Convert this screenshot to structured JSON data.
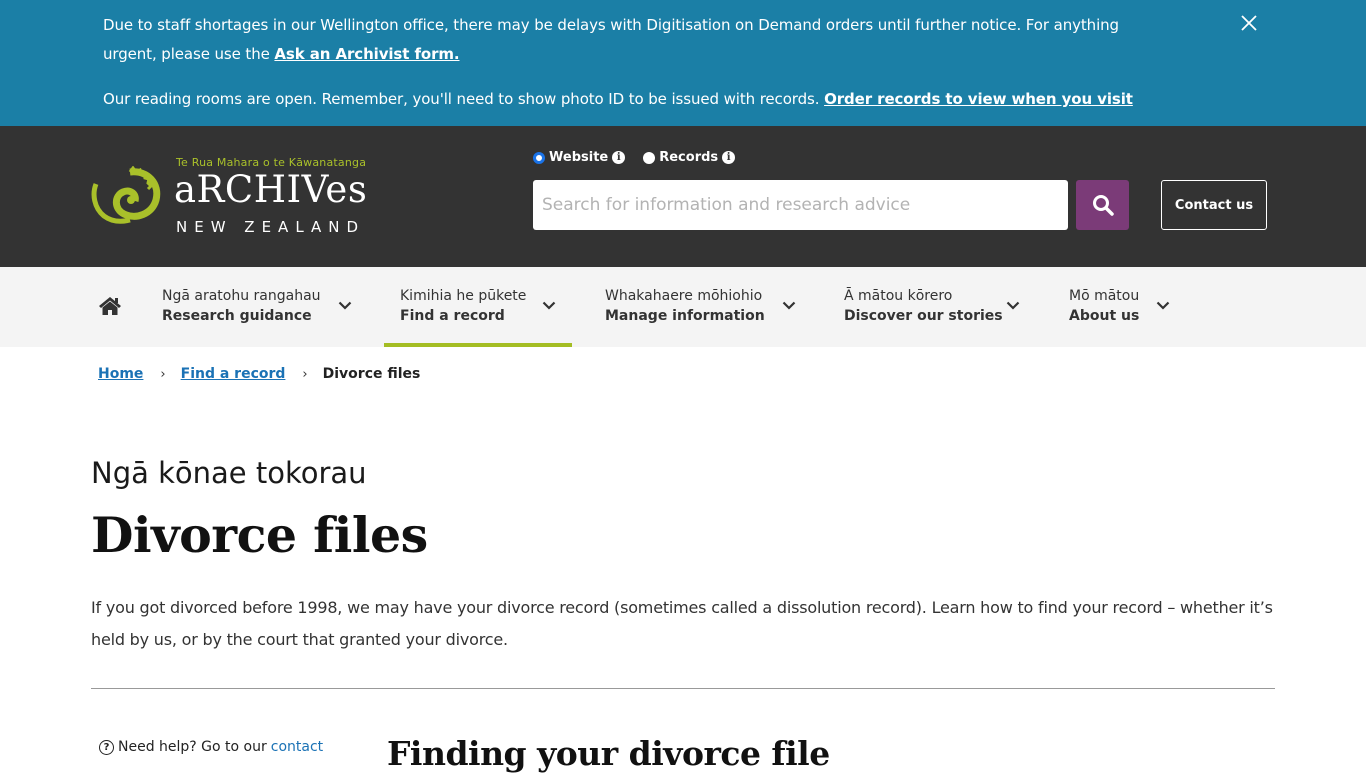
{
  "alert": {
    "line1_text": "Due to staff shortages in our Wellington office, there may be delays with Digitisation on Demand orders until further notice. For anything urgent, please use the ",
    "line1_link": "Ask an Archivist form.",
    "line2_text": "Our reading rooms are open. Remember, you'll need to show photo ID to be issued with records. ",
    "line2_link": "Order records to view when you visit",
    "close_icon": "close-icon",
    "background": "#1b7fa6"
  },
  "header": {
    "logo": {
      "tagline": "Te Rua Mahara o te Kāwanatanga",
      "wordmark": "aRCHIVes",
      "subtext": "NEW ZEALAND",
      "accent": "#a9c02a"
    },
    "search": {
      "options": [
        {
          "label": "Website",
          "checked": true
        },
        {
          "label": "Records",
          "checked": false
        }
      ],
      "placeholder": "Search for information and research advice",
      "value": "",
      "button_icon": "search-icon",
      "button_color": "#7b3b78"
    },
    "contact_label": "Contact us"
  },
  "nav": {
    "home_icon": "home-icon",
    "items": [
      {
        "mi": "Ngā aratohu rangahau",
        "en": "Research guidance",
        "active": false
      },
      {
        "mi": "Kimihia he pūkete",
        "en": "Find a record",
        "active": true
      },
      {
        "mi": "Whakahaere mōhiohio",
        "en": "Manage information",
        "active": false
      },
      {
        "mi": "Ā mātou kōrero",
        "en": "Discover our stories",
        "active": false
      },
      {
        "mi": "Mō mātou",
        "en": "About us",
        "active": false
      }
    ],
    "active_color": "#a4bd23"
  },
  "breadcrumb": {
    "items": [
      "Home",
      "Find a record"
    ],
    "current": "Divorce files",
    "separator": "›"
  },
  "page": {
    "subtitle": "Ngā kōnae tokorau",
    "title": "Divorce files",
    "intro": "If you got divorced before 1998, we may have your divorce record (sometimes called a dissolution record). Learn how to find your record – whether it’s held by us, or by the court that granted your divorce.",
    "help_text": "Need help? Go to our ",
    "help_link": "contact",
    "section_heading": "Finding your divorce file"
  }
}
